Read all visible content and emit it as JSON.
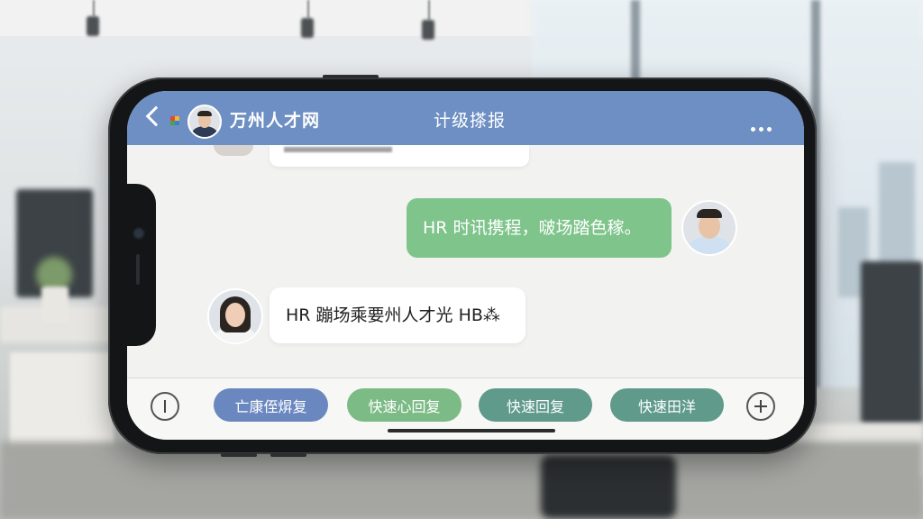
{
  "header": {
    "brand": "万州人才网",
    "title": "计级搽报"
  },
  "messages": [
    {
      "direction": "outgoing",
      "text": "HR 时讯携程，啵场踏色稼。"
    },
    {
      "direction": "incoming",
      "text": "HR 蹦场乘要州人才光 HB⁂"
    }
  ],
  "quick_replies": [
    {
      "label": "亡康侄焺复",
      "color": "#6a88bf"
    },
    {
      "label": "快速心回复",
      "color": "#7cbb85"
    },
    {
      "label": "快速回复",
      "color": "#5f9a8a"
    },
    {
      "label": "快速田洋",
      "color": "#5f9a8a"
    }
  ],
  "icons": [
    "back-chevron-icon",
    "logo-icon",
    "more-icon",
    "voice-toggle-icon",
    "add-icon"
  ]
}
